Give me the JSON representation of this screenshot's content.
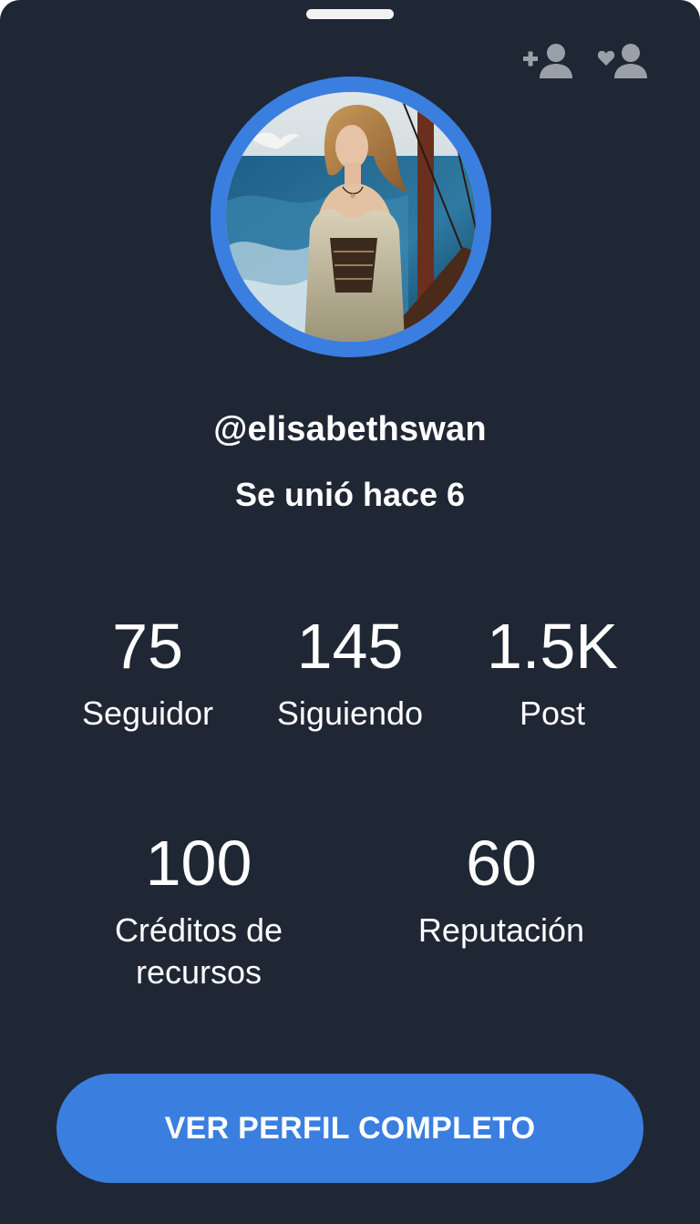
{
  "profile": {
    "username": "@elisabethswan",
    "joined_text": "Se unió hace 6",
    "avatar_alt": "avatar"
  },
  "stats": [
    {
      "value": "75",
      "label": "Seguidor"
    },
    {
      "value": "145",
      "label": "Siguiendo"
    },
    {
      "value": "1.5K",
      "label": "Post"
    },
    {
      "value": "100",
      "label": "Créditos de recursos"
    },
    {
      "value": "60",
      "label": "Reputación"
    }
  ],
  "actions": {
    "follow_icon": "person-add-icon",
    "favorite_icon": "person-heart-icon",
    "view_full_profile_label": "VER PERFIL COMPLETO"
  },
  "colors": {
    "background": "#1f2735",
    "accent": "#3a7ee0",
    "icon": "#9aa0a8"
  }
}
